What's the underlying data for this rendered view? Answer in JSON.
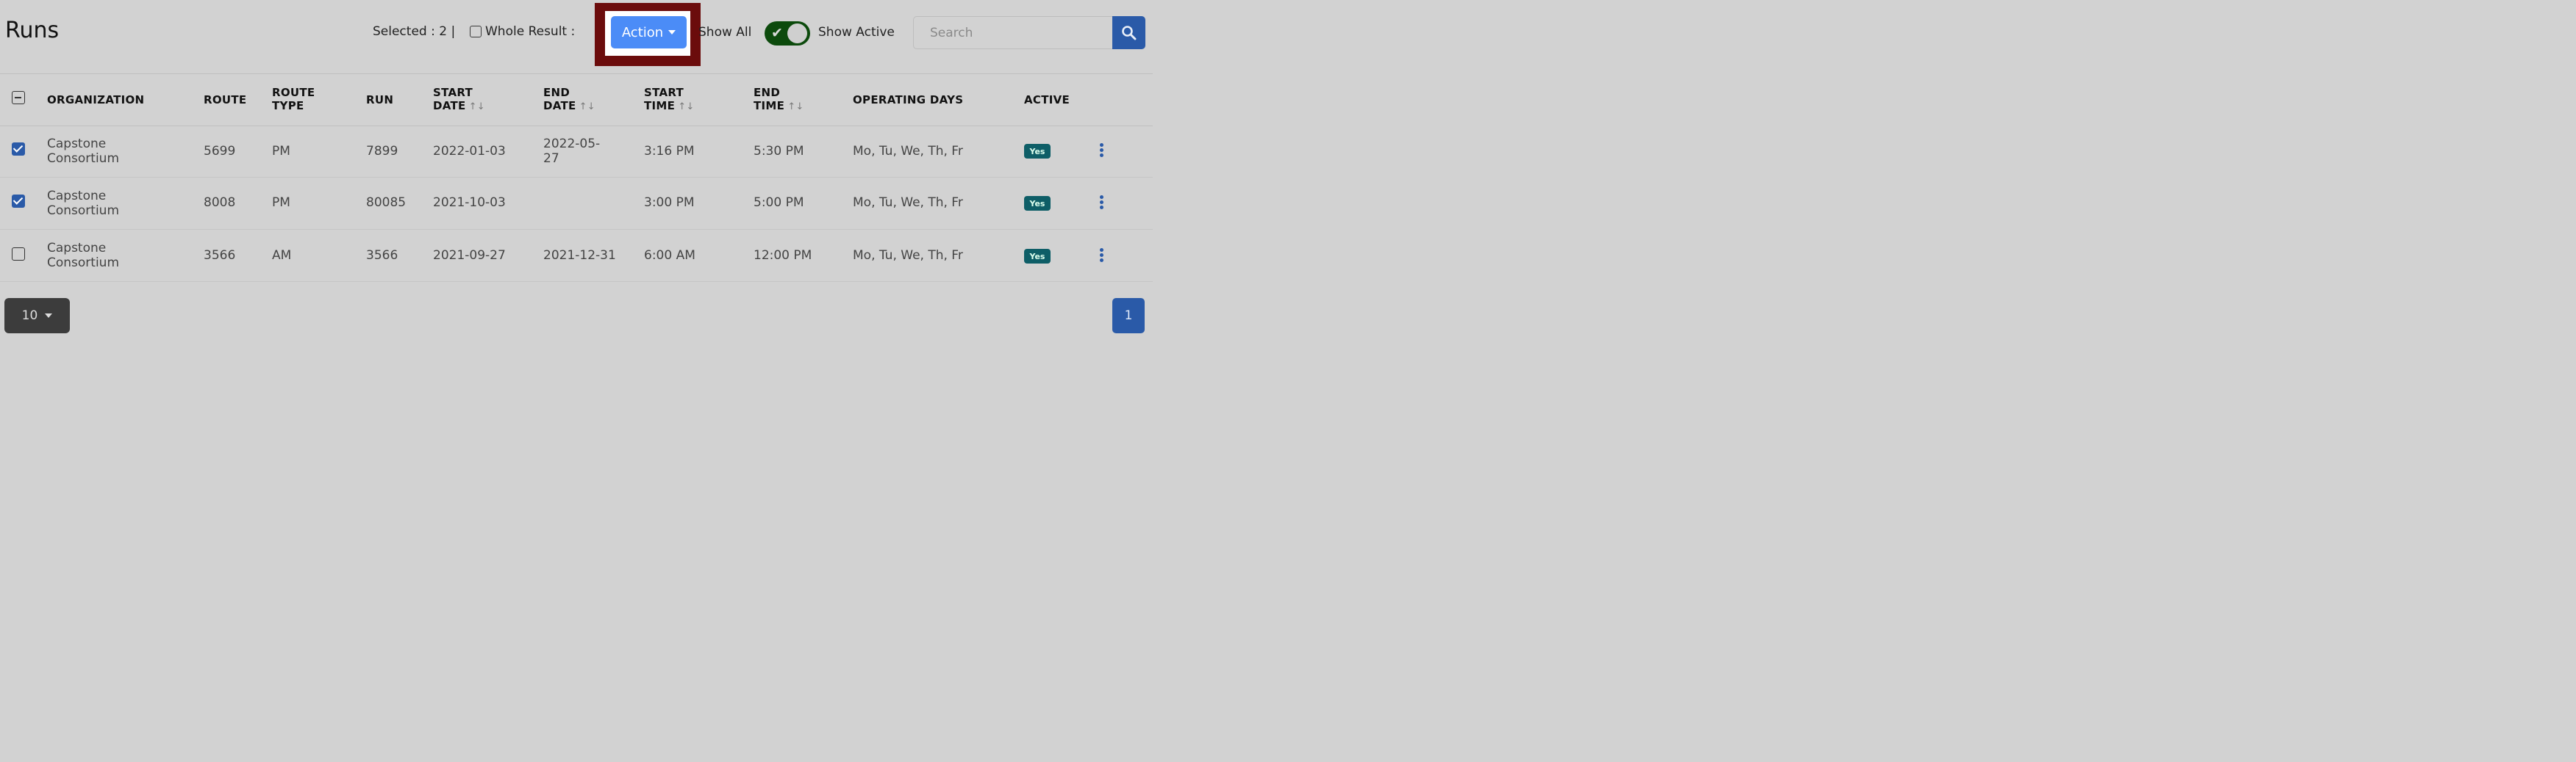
{
  "header": {
    "title": "Runs",
    "selected_text": "Selected : 2 |",
    "whole_result_label": "Whole Result :",
    "action_label": "Action",
    "show_all_label": "Show All",
    "show_active_label": "Show Active",
    "search_placeholder": "Search"
  },
  "table": {
    "headers": {
      "organization": "ORGANIZATION",
      "route": "ROUTE",
      "route_type_1": "ROUTE",
      "route_type_2": "TYPE",
      "run": "RUN",
      "start_date_1": "START",
      "start_date_2": "DATE",
      "end_date_1": "END",
      "end_date_2": "DATE",
      "start_time_1": "START",
      "start_time_2": "TIME",
      "end_time_1": "END",
      "end_time_2": "TIME",
      "operating_days": "OPERATING DAYS",
      "active": "ACTIVE"
    },
    "rows": [
      {
        "checked": true,
        "org_1": "Capstone",
        "org_2": "Consortium",
        "route": "5699",
        "route_type": "PM",
        "run": "7899",
        "start_date": "2022-01-03",
        "end_date_1": "2022-05-",
        "end_date_2": "27",
        "start_time": "3:16 PM",
        "end_time": "5:30 PM",
        "days": "Mo, Tu, We, Th, Fr",
        "active": "Yes"
      },
      {
        "checked": true,
        "org_1": "Capstone",
        "org_2": "Consortium",
        "route": "8008",
        "route_type": "PM",
        "run": "80085",
        "start_date": "2021-10-03",
        "end_date_1": "",
        "end_date_2": "",
        "start_time": "3:00 PM",
        "end_time": "5:00 PM",
        "days": "Mo, Tu, We, Th, Fr",
        "active": "Yes"
      },
      {
        "checked": false,
        "org_1": "Capstone",
        "org_2": "Consortium",
        "route": "3566",
        "route_type": "AM",
        "run": "3566",
        "start_date": "2021-09-27",
        "end_date_1": "2021-12-31",
        "end_date_2": "",
        "start_time": "6:00 AM",
        "end_time": "12:00 PM",
        "days": "Mo, Tu, We, Th, Fr",
        "active": "Yes"
      }
    ]
  },
  "footer": {
    "per_page": "10",
    "page": "1"
  },
  "toggle": {
    "show_active": true
  },
  "colors": {
    "accent": "#4b8cf7",
    "highlight": "#6b0c0c",
    "badge": "#0e5e67"
  }
}
